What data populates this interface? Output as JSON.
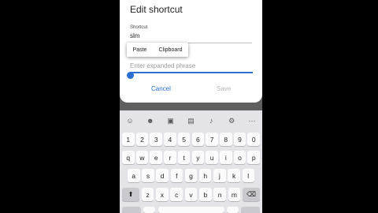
{
  "dialog": {
    "title": "Edit shortcut",
    "shortcut_label": "Shortcut",
    "shortcut_value": "slm",
    "expanded_placeholder": "Enter expanded phrase",
    "cancel_label": "Cancel",
    "save_label": "Save"
  },
  "context_menu": {
    "paste_label": "Paste",
    "clipboard_label": "Clipboard"
  },
  "keyboard": {
    "toolbar_icons": [
      "expression-icon",
      "emoji-icon",
      "sticker-icon",
      "clipboard-icon",
      "mic-icon",
      "gear-icon",
      "more-icon"
    ],
    "toolbar_glyphs": [
      "☺",
      "☻",
      "▣",
      "▤",
      "♪",
      "⚙",
      "⋯"
    ],
    "number_row": [
      "1",
      "2",
      "3",
      "4",
      "5",
      "6",
      "7",
      "8",
      "9",
      "0"
    ],
    "row1": [
      "q",
      "w",
      "e",
      "r",
      "t",
      "y",
      "u",
      "i",
      "o",
      "p"
    ],
    "row2": [
      "a",
      "s",
      "d",
      "f",
      "g",
      "h",
      "j",
      "k",
      "l"
    ],
    "row3": [
      "z",
      "x",
      "c",
      "v",
      "b",
      "n",
      "m"
    ],
    "shift_glyph": "⬆",
    "backspace_glyph": "⌫"
  }
}
